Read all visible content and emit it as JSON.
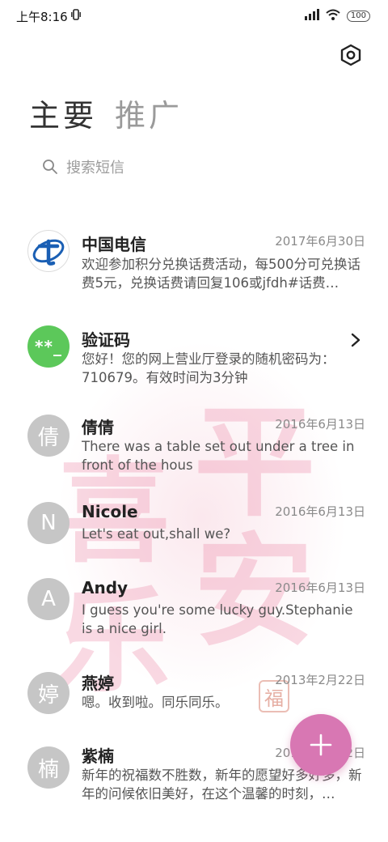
{
  "status_bar": {
    "time": "上午8:16",
    "battery": "100",
    "icons": [
      "vibrate-icon",
      "signal-icon",
      "wifi-icon",
      "battery-icon"
    ]
  },
  "header": {
    "settings_icon": "settings-hexagon-icon",
    "tabs": [
      {
        "label": "主要",
        "active": true
      },
      {
        "label": "推广",
        "active": false
      }
    ]
  },
  "search": {
    "icon": "search-icon",
    "placeholder": "搜索短信"
  },
  "conversations": [
    {
      "name": "中国电信",
      "date": "2017年6月30日",
      "preview": "欢迎参加积分兑换话费活动，每500分可兑换话费5元，兑换话费请回复106或jfdh#话费…",
      "avatar": "china-telecom-logo"
    },
    {
      "name": "验证码",
      "date": "",
      "preview": "您好！您的网上营业厅登录的随机密码为：710679。有效时间为3分钟",
      "avatar_text": "**_"
    },
    {
      "name": "倩倩",
      "date": "2016年6月13日",
      "preview": "There was a table set out under a tree in front of the hous",
      "avatar_text": "倩"
    },
    {
      "name": "Nicole",
      "date": "2016年6月13日",
      "preview": "Let's eat out,shall we?",
      "avatar_text": "N"
    },
    {
      "name": "Andy",
      "date": "2016年6月13日",
      "preview": "I guess you're some lucky guy.Stephanie is a nice girl.",
      "avatar_text": "A"
    },
    {
      "name": "燕婷",
      "date": "2013年2月22日",
      "preview": "嗯。收到啦。同乐同乐。",
      "avatar_text": "婷"
    },
    {
      "name": "紫楠",
      "date": "2013年2月22日",
      "preview": "新年的祝福数不胜数，新年的愿望好多好多，新年的问候依旧美好，在这个温馨的时刻，…",
      "avatar_text": "楠"
    }
  ],
  "watermark": {
    "characters": [
      "平",
      "安",
      "喜",
      "乐"
    ],
    "seal": "福"
  },
  "fab": {
    "icon": "plus-icon"
  },
  "colors": {
    "accent": "#d877b3",
    "avatar_gray": "#c6c6c6",
    "avatar_green": "#5cc85a",
    "telecom_blue": "#1a5fb4"
  }
}
